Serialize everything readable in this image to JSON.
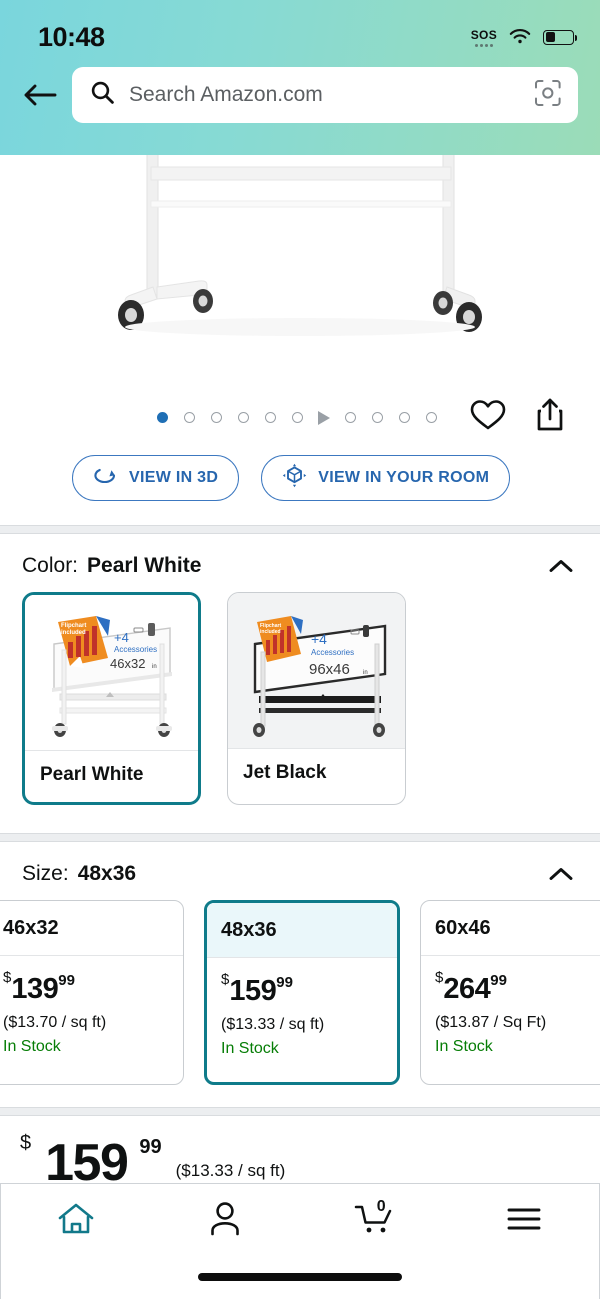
{
  "status_bar": {
    "time": "10:48",
    "sos_label": "SOS",
    "wifi_icon": "wifi-icon",
    "battery_icon": "battery-icon",
    "battery_level_percent": 32
  },
  "header": {
    "back_icon": "back-arrow-icon",
    "search": {
      "placeholder": "Search Amazon.com",
      "search_icon": "search-icon",
      "camera_icon": "camera-scan-icon"
    },
    "gradient_from": "#7ad6dd",
    "gradient_to": "#9bdcb8"
  },
  "gallery": {
    "image_alt": "mobile-whiteboard-stand",
    "indicators": [
      {
        "type": "dot",
        "active": true
      },
      {
        "type": "dot",
        "active": false
      },
      {
        "type": "dot",
        "active": false
      },
      {
        "type": "dot",
        "active": false
      },
      {
        "type": "dot",
        "active": false
      },
      {
        "type": "dot",
        "active": false
      },
      {
        "type": "play",
        "active": false
      },
      {
        "type": "dot",
        "active": false
      },
      {
        "type": "dot",
        "active": false
      },
      {
        "type": "dot",
        "active": false
      },
      {
        "type": "dot",
        "active": false
      }
    ],
    "wishlist_icon": "heart-icon",
    "share_icon": "share-icon",
    "view_3d_label": "VIEW IN 3D",
    "view_3d_icon": "rotate-3d-icon",
    "view_room_label": "VIEW IN YOUR ROOM",
    "view_room_icon": "ar-cube-icon",
    "accent_blue": "#2766ae"
  },
  "color_section": {
    "label": "Color:",
    "selected": "Pearl White",
    "collapse_icon": "chevron-up-icon",
    "options": [
      {
        "name": "Pearl White",
        "selected": true,
        "badge_top": "Flipchart included",
        "badge_plus": "+4",
        "badge_accessories": "Accessories",
        "badge_size": "46x32",
        "badge_unit": "in"
      },
      {
        "name": "Jet Black",
        "selected": false,
        "badge_top": "Flipchart included",
        "badge_plus": "+4",
        "badge_accessories": "Accessories",
        "badge_size": "96x46",
        "badge_unit": "in"
      }
    ],
    "selected_border_color": "#0f7b8a"
  },
  "size_section": {
    "label": "Size:",
    "selected": "48x36",
    "collapse_icon": "chevron-up-icon",
    "options": [
      {
        "size": "46x32",
        "currency": "$",
        "price_int": "139",
        "price_frac": "99",
        "unit_price": "($13.70 / sq ft)",
        "availability": "In Stock",
        "selected": false
      },
      {
        "size": "48x36",
        "currency": "$",
        "price_int": "159",
        "price_frac": "99",
        "unit_price": "($13.33 / sq ft)",
        "availability": "In Stock",
        "selected": true
      },
      {
        "size": "60x46",
        "currency": "$",
        "price_int": "264",
        "price_frac": "99",
        "unit_price": "($13.87 / Sq Ft)",
        "availability": "In Stock",
        "selected": false
      }
    ],
    "stock_color": "#067d06"
  },
  "main_price": {
    "currency": "$",
    "integer": "159",
    "fraction": "99",
    "unit_price": "($13.33 / sq ft)"
  },
  "bottom_nav": {
    "active_color": "#12798a",
    "items": [
      {
        "name": "home",
        "icon": "home-icon",
        "active": true
      },
      {
        "name": "account",
        "icon": "person-icon",
        "active": false
      },
      {
        "name": "cart",
        "icon": "cart-icon",
        "active": false,
        "badge": "0"
      },
      {
        "name": "menu",
        "icon": "hamburger-menu-icon",
        "active": false
      }
    ]
  }
}
